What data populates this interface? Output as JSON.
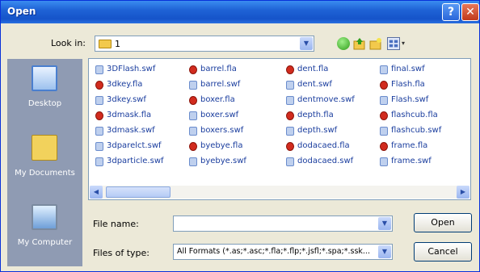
{
  "window": {
    "title": "Open",
    "help_glyph": "?",
    "close_glyph": "✕"
  },
  "toolbar": {
    "look_in_label": "Look in:",
    "look_in_value": "1",
    "dropdown_glyph": "▼",
    "views_arrow": "▾"
  },
  "places": [
    {
      "label": "Desktop",
      "icon": "desktop-icon"
    },
    {
      "label": "My Documents",
      "icon": "my-documents-icon"
    },
    {
      "label": "My Computer",
      "icon": "my-computer-icon"
    }
  ],
  "files": {
    "columns": [
      [
        {
          "name": "3DFlash.swf",
          "type": "swf"
        },
        {
          "name": "3dkey.fla",
          "type": "fla"
        },
        {
          "name": "3dkey.swf",
          "type": "swf"
        },
        {
          "name": "3dmask.fla",
          "type": "fla"
        },
        {
          "name": "3dmask.swf",
          "type": "swf"
        },
        {
          "name": "3dparelct.swf",
          "type": "swf"
        },
        {
          "name": "3dparticle.swf",
          "type": "swf"
        }
      ],
      [
        {
          "name": "barrel.fla",
          "type": "fla"
        },
        {
          "name": "barrel.swf",
          "type": "swf"
        },
        {
          "name": "boxer.fla",
          "type": "fla"
        },
        {
          "name": "boxer.swf",
          "type": "swf"
        },
        {
          "name": "boxers.swf",
          "type": "swf"
        },
        {
          "name": "byebye.fla",
          "type": "fla"
        },
        {
          "name": "byebye.swf",
          "type": "swf"
        }
      ],
      [
        {
          "name": "dent.fla",
          "type": "fla"
        },
        {
          "name": "dent.swf",
          "type": "swf"
        },
        {
          "name": "dentmove.swf",
          "type": "swf"
        },
        {
          "name": "depth.fla",
          "type": "fla"
        },
        {
          "name": "depth.swf",
          "type": "swf"
        },
        {
          "name": "dodacaed.fla",
          "type": "fla"
        },
        {
          "name": "dodacaed.swf",
          "type": "swf"
        }
      ],
      [
        {
          "name": "final.swf",
          "type": "swf"
        },
        {
          "name": "Flash.fla",
          "type": "fla"
        },
        {
          "name": "Flash.swf",
          "type": "swf"
        },
        {
          "name": "flashcub.fla",
          "type": "fla"
        },
        {
          "name": "flashcub.swf",
          "type": "swf"
        },
        {
          "name": "frame.fla",
          "type": "fla"
        },
        {
          "name": "frame.swf",
          "type": "swf"
        }
      ]
    ]
  },
  "scrollbar": {
    "left_glyph": "◀",
    "right_glyph": "▶"
  },
  "form": {
    "file_name_label": "File name:",
    "file_name_value": "",
    "files_of_type_label": "Files of type:",
    "files_of_type_value": "All Formats (*.as;*.asc;*.fla;*.flp;*.jsfl;*.spa;*.ssk...",
    "open_label": "Open",
    "cancel_label": "Cancel"
  }
}
